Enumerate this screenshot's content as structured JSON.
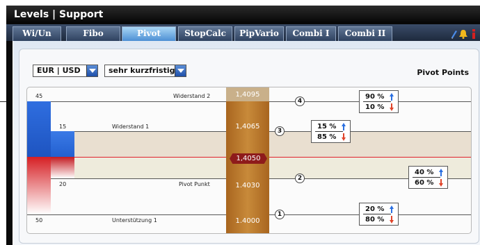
{
  "window": {
    "title": "Levels | Support"
  },
  "tabs": [
    {
      "label": "Wi/Un",
      "active": false
    },
    {
      "label": "Fibo",
      "active": false
    },
    {
      "label": "Pivot",
      "active": true
    },
    {
      "label": "StopCalc",
      "active": false
    },
    {
      "label": "PipVario",
      "active": false
    },
    {
      "label": "Combi I",
      "active": false
    },
    {
      "label": "Combi II",
      "active": false
    }
  ],
  "toolbar": {
    "pair_select": "EUR | USD",
    "horizon_select": "sehr kurzfristig",
    "panel_title": "Pivot Points"
  },
  "levels": [
    {
      "name": "Widerstand 2",
      "price": "1,4095",
      "count": "45",
      "circle": "4",
      "up": "90 %",
      "down": "10 %"
    },
    {
      "name": "Widerstand 1",
      "price": "1,4065",
      "count": "15",
      "circle": "3",
      "up": "15 %",
      "down": "85 %"
    },
    {
      "name": "Pivot Punkt",
      "price": "1.4030",
      "count": "20",
      "circle": "2",
      "up": "40 %",
      "down": "60 %"
    },
    {
      "name": "Unterstützung 1",
      "price": "1.4000",
      "count": "50",
      "circle": "1",
      "up": "20 %",
      "down": "80 %"
    }
  ],
  "current_price": "1,4050",
  "colors": {
    "resistance_bar": "#2f6ee0",
    "support_bar": "#d61f24",
    "arrow_up": "#2a6fe0",
    "arrow_down": "#e0442a",
    "price_column": "#b87530",
    "current_badge": "#8e1b1b"
  },
  "icons": [
    "pen-icon",
    "bell-icon",
    "info-icon"
  ]
}
